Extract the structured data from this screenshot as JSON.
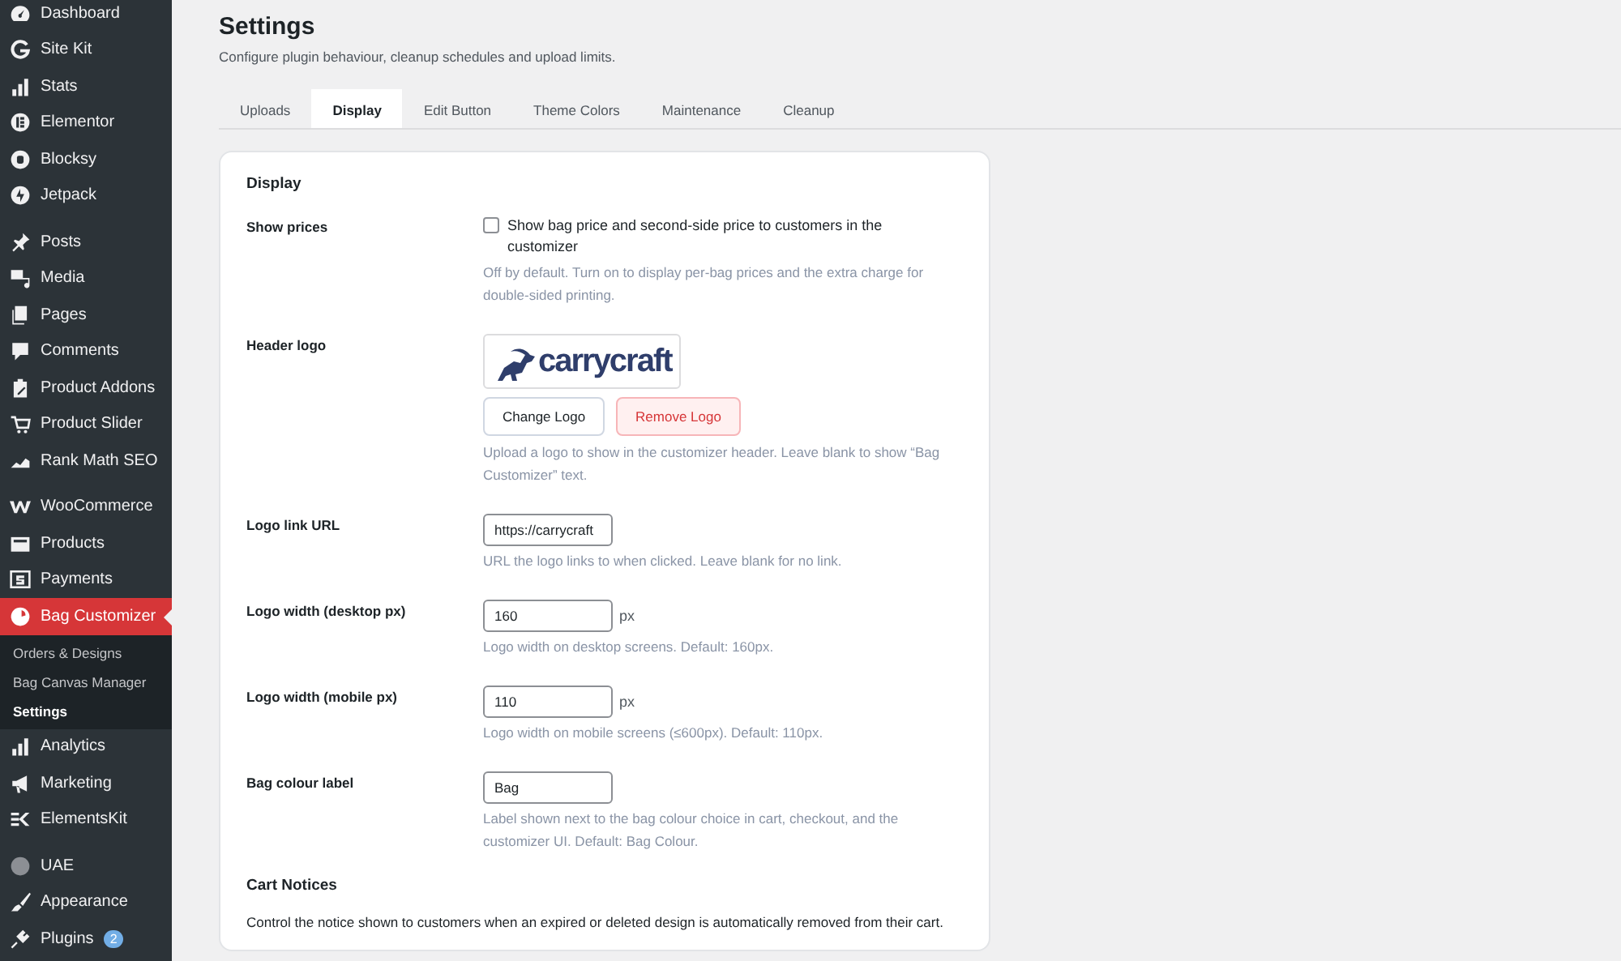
{
  "sidebar": {
    "groups": [
      [
        {
          "label": "Dashboard",
          "selected": false
        },
        {
          "label": "Site Kit",
          "selected": false
        },
        {
          "label": "Stats",
          "selected": false
        },
        {
          "label": "Elementor",
          "selected": false
        },
        {
          "label": "Blocksy",
          "selected": false
        },
        {
          "label": "Jetpack",
          "selected": false
        }
      ],
      [
        {
          "label": "Posts",
          "selected": false
        },
        {
          "label": "Media",
          "selected": false
        },
        {
          "label": "Pages",
          "selected": false
        },
        {
          "label": "Comments",
          "selected": false
        },
        {
          "label": "Product Addons",
          "selected": false
        },
        {
          "label": "Product Slider",
          "selected": false
        },
        {
          "label": "Rank Math SEO",
          "selected": false
        }
      ],
      [
        {
          "label": "WooCommerce",
          "selected": false
        },
        {
          "label": "Products",
          "selected": false
        },
        {
          "label": "Payments",
          "selected": false
        },
        {
          "label": "Bag Customizer",
          "selected": true,
          "children": [
            {
              "label": "Orders & Designs",
              "selected": false
            },
            {
              "label": "Bag Canvas Manager",
              "selected": false
            },
            {
              "label": "Settings",
              "selected": true
            }
          ]
        },
        {
          "label": "Analytics",
          "selected": false
        },
        {
          "label": "Marketing",
          "selected": false
        },
        {
          "label": "ElementsKit",
          "selected": false
        }
      ],
      [
        {
          "label": "UAE",
          "selected": false
        },
        {
          "label": "Appearance",
          "selected": false
        },
        {
          "label": "Plugins",
          "selected": false,
          "badge": "2"
        }
      ]
    ]
  },
  "page": {
    "title": "Settings",
    "subtitle": "Configure plugin behaviour, cleanup schedules and upload limits."
  },
  "tabs": [
    {
      "label": "Uploads",
      "selected": false
    },
    {
      "label": "Display",
      "selected": true
    },
    {
      "label": "Edit Button",
      "selected": false
    },
    {
      "label": "Theme Colors",
      "selected": false
    },
    {
      "label": "Maintenance",
      "selected": false
    },
    {
      "label": "Cleanup",
      "selected": false
    }
  ],
  "card": {
    "title": "Display",
    "fields": [
      {
        "kind": "checkbox",
        "label": "Show prices",
        "checked": false,
        "text": "Show bag price and second-side price to customers in the customizer",
        "hint": "Off by default. Turn on to display per-bag prices and the extra charge for double-sided printing."
      },
      {
        "kind": "logo",
        "label": "Header logo",
        "logo_text": "carrycraft",
        "buttons": [
          {
            "label": "Change Logo",
            "kind": "default"
          },
          {
            "label": "Remove Logo",
            "kind": "danger"
          }
        ],
        "hint": "Upload a logo to show in the customizer header. Leave blank to show “Bag Customizer” text."
      },
      {
        "kind": "text",
        "label": "Logo link URL",
        "value": "https://carrycraft",
        "hint": "URL the logo links to when clicked. Leave blank for no link."
      },
      {
        "kind": "text",
        "label": "Logo width (desktop px)",
        "value": "160",
        "unit": "px",
        "hint": "Logo width on desktop screens. Default: 160px."
      },
      {
        "kind": "text",
        "label": "Logo width (mobile px)",
        "value": "110",
        "unit": "px",
        "hint": "Logo width on mobile screens (≤600px). Default: 110px."
      },
      {
        "kind": "text",
        "label": "Bag colour label",
        "value": "Bag",
        "hint": "Label shown next to the bag colour choice in cart, checkout, and the customizer UI. Default: Bag Colour."
      }
    ],
    "sections": [
      {
        "title": "Cart Notices",
        "description": "Control the notice shown to customers when an expired or deleted design is automatically removed from their cart."
      }
    ]
  }
}
